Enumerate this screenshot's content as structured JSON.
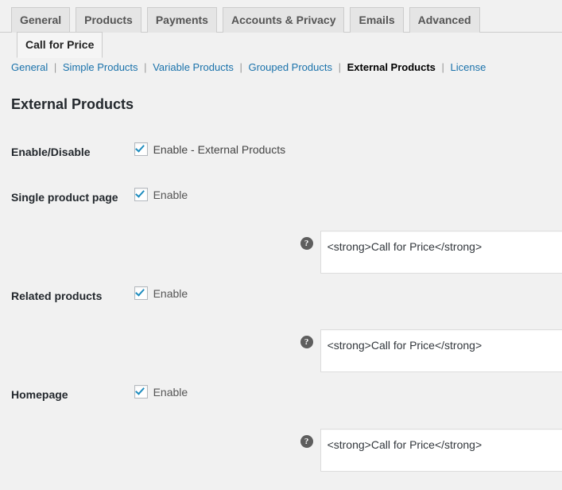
{
  "tabs": [
    {
      "label": "General",
      "active": false
    },
    {
      "label": "Products",
      "active": false
    },
    {
      "label": "Payments",
      "active": false
    },
    {
      "label": "Accounts & Privacy",
      "active": false
    },
    {
      "label": "Emails",
      "active": false
    },
    {
      "label": "Advanced",
      "active": false
    },
    {
      "label": "Call for Price",
      "active": true
    }
  ],
  "subnav": [
    {
      "label": "General",
      "current": false
    },
    {
      "label": "Simple Products",
      "current": false
    },
    {
      "label": "Variable Products",
      "current": false
    },
    {
      "label": "Grouped Products",
      "current": false
    },
    {
      "label": "External Products",
      "current": true
    },
    {
      "label": "License",
      "current": false
    }
  ],
  "subnav_separator": "|",
  "page_title": "External Products",
  "help_icon_glyph": "?",
  "rows": {
    "enable_disable": {
      "label": "Enable/Disable",
      "checkbox_label": "Enable - External Products",
      "checked": true
    },
    "single_product_page": {
      "label": "Single product page",
      "checkbox_label": "Enable",
      "checked": true,
      "textarea_value": "<strong>Call for Price</strong>"
    },
    "related_products": {
      "label": "Related products",
      "checkbox_label": "Enable",
      "checked": true,
      "textarea_value": "<strong>Call for Price</strong>"
    },
    "homepage": {
      "label": "Homepage",
      "checkbox_label": "Enable",
      "checked": true,
      "textarea_value": "<strong>Call for Price</strong>"
    }
  },
  "colors": {
    "link": "#1a72ab",
    "checkmark": "#1e8cbe",
    "page_bg": "#f1f1f1",
    "active_tab_bg": "#f5f5f5",
    "tab_bg": "#e5e5e5"
  }
}
